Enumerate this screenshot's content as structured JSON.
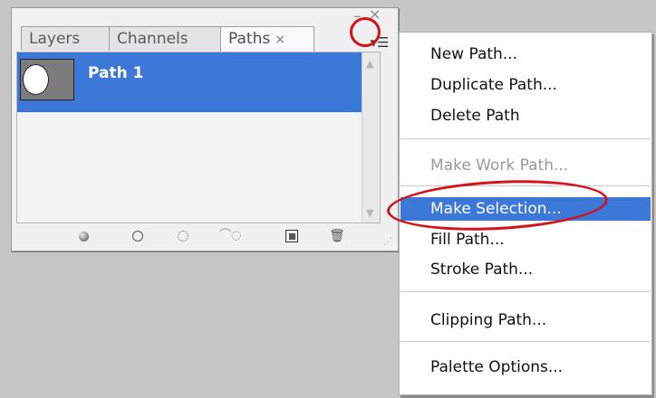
{
  "panel": {
    "tabs": [
      {
        "label": "Layers"
      },
      {
        "label": "Channels"
      },
      {
        "label": "Paths",
        "close": "×"
      }
    ],
    "window": {
      "minimize": "–",
      "close": "×"
    },
    "menu_button": "▾☰",
    "paths": [
      {
        "name": "Path 1",
        "selected": true
      }
    ],
    "toolbar": [
      {
        "icon": "fill-path-icon"
      },
      {
        "icon": "stroke-path-icon"
      },
      {
        "icon": "load-selection-icon"
      },
      {
        "icon": "make-work-path-icon"
      },
      {
        "icon": "new-path-icon"
      },
      {
        "icon": "trash-icon"
      }
    ],
    "selection_color": "#3c78d8"
  },
  "menu": {
    "items": [
      {
        "label": "New Path..."
      },
      {
        "label": "Duplicate Path..."
      },
      {
        "label": "Delete Path"
      },
      {
        "label": "Make Work Path...",
        "disabled": true
      },
      {
        "label": "Make Selection...",
        "highlighted": true
      },
      {
        "label": "Fill Path..."
      },
      {
        "label": "Stroke Path..."
      },
      {
        "label": "Clipping Path..."
      },
      {
        "label": "Palette Options..."
      }
    ]
  },
  "annotation_color": "#d4121b"
}
